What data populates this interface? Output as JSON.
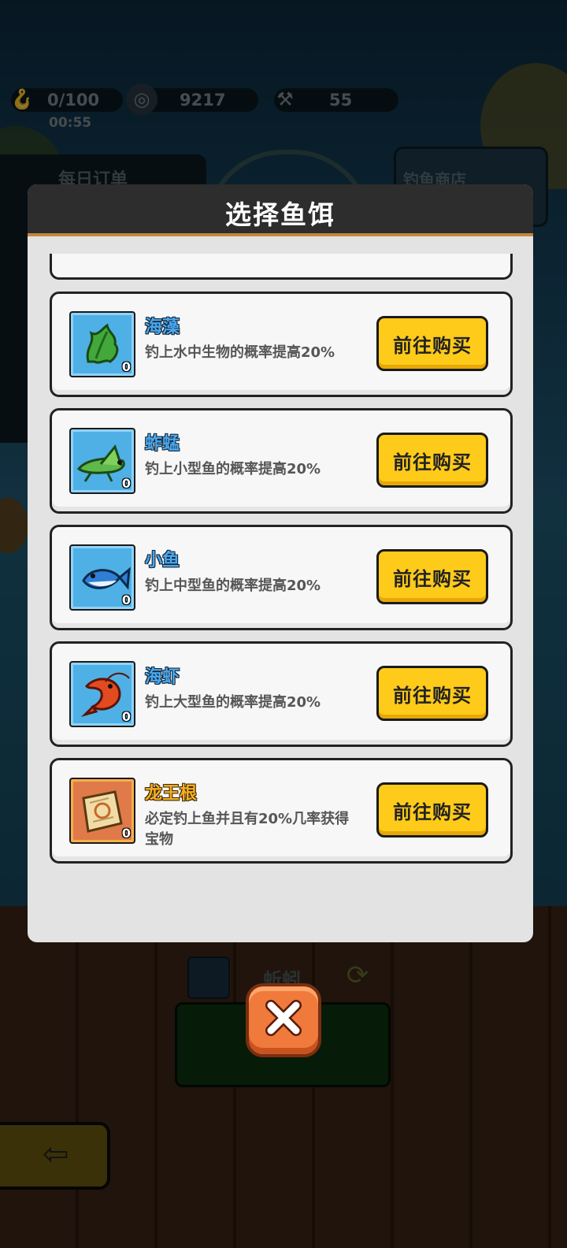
{
  "hud": {
    "fish_count": "0/100",
    "timer": "00:55",
    "coins": "9217",
    "hammers": "55"
  },
  "background": {
    "daily_orders": "每日订单",
    "fishing_shop": "钓鱼商店",
    "current_bait": "蚯蚓"
  },
  "modal": {
    "title": "选择鱼饵",
    "items": [
      {
        "name": "海藻",
        "desc": "钓上水中生物的概率提高20%",
        "count": "0",
        "button": "前往购买",
        "icon": "seaweed-icon"
      },
      {
        "name": "蚱蜢",
        "desc": "钓上小型鱼的概率提高20%",
        "count": "0",
        "button": "前往购买",
        "icon": "grasshopper-icon"
      },
      {
        "name": "小鱼",
        "desc": "钓上中型鱼的概率提高20%",
        "count": "0",
        "button": "前往购买",
        "icon": "small-fish-icon"
      },
      {
        "name": "海虾",
        "desc": "钓上大型鱼的概率提高20%",
        "count": "0",
        "button": "前往购买",
        "icon": "shrimp-icon"
      },
      {
        "name": "龙王根",
        "desc": "必定钓上鱼并且有20%几率获得宝物",
        "count": "0",
        "button": "前往购买",
        "icon": "dragon-king-root-icon"
      }
    ]
  },
  "colors": {
    "buy_button": "#ffcb1a",
    "name_blue": "#4aa8ee",
    "name_gold": "#f5b022",
    "close_button": "#f07a3c"
  }
}
